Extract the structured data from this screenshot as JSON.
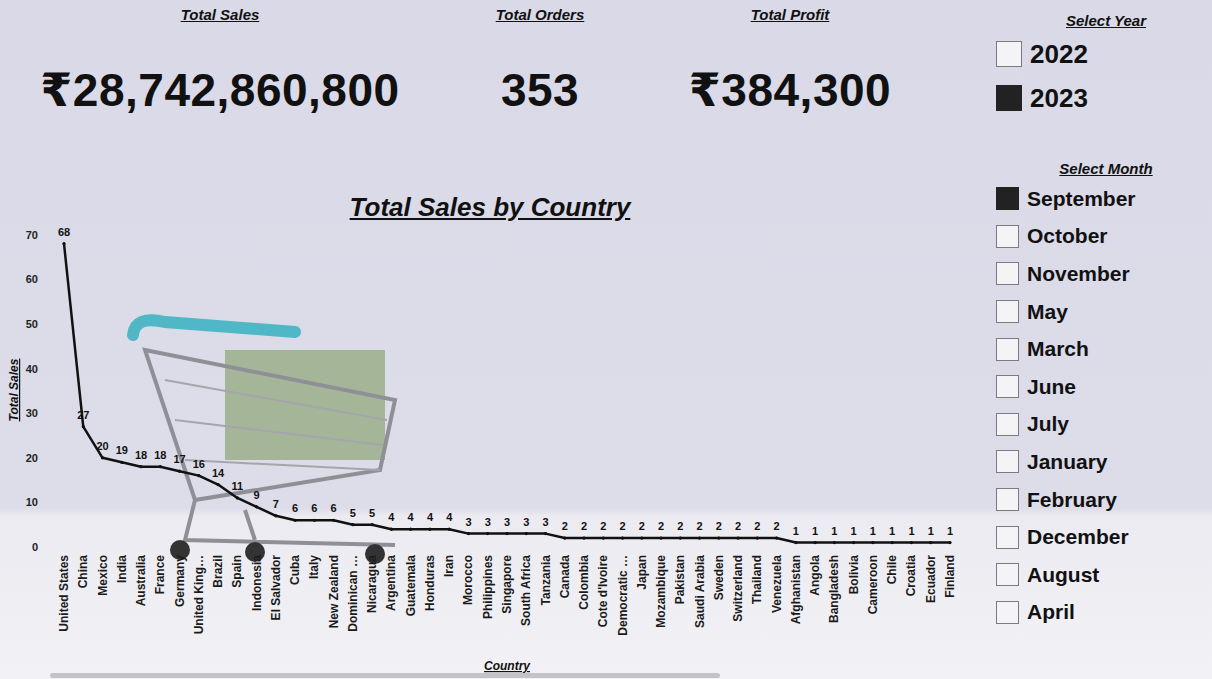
{
  "kpis": [
    {
      "title": "Total Sales",
      "value": "₹28,742,860,800"
    },
    {
      "title": "Total Orders",
      "value": "353"
    },
    {
      "title": "Total Profit",
      "value": "₹384,300"
    }
  ],
  "year_slicer": {
    "title": "Select Year",
    "items": [
      {
        "label": "2022",
        "selected": false
      },
      {
        "label": "2023",
        "selected": true
      }
    ]
  },
  "month_slicer": {
    "title": "Select Month",
    "items": [
      {
        "label": "September",
        "selected": true
      },
      {
        "label": "October",
        "selected": false
      },
      {
        "label": "November",
        "selected": false
      },
      {
        "label": "May",
        "selected": false
      },
      {
        "label": "March",
        "selected": false
      },
      {
        "label": "June",
        "selected": false
      },
      {
        "label": "July",
        "selected": false
      },
      {
        "label": "January",
        "selected": false
      },
      {
        "label": "February",
        "selected": false
      },
      {
        "label": "December",
        "selected": false
      },
      {
        "label": "August",
        "selected": false
      },
      {
        "label": "April",
        "selected": false
      }
    ]
  },
  "chart": {
    "title": "Total Sales by Country",
    "y_axis_title": "Total Sales",
    "x_axis_title": "Country",
    "y_ticks": [
      "0",
      "10",
      "20",
      "30",
      "40",
      "50",
      "60",
      "70"
    ],
    "categories": [
      "United States",
      "China",
      "Mexico",
      "India",
      "Australia",
      "France",
      "Germany",
      "United King…",
      "Brazil",
      "Spain",
      "Indonesia",
      "El Salvador",
      "Cuba",
      "Italy",
      "New Zealand",
      "Dominican …",
      "Nicaragua",
      "Argentina",
      "Guatemala",
      "Honduras",
      "Iran",
      "Morocco",
      "Philippines",
      "Singapore",
      "South Africa",
      "Tanzania",
      "Canada",
      "Colombia",
      "Cote d'Ivoire",
      "Democratic …",
      "Japan",
      "Mozambique",
      "Pakistan",
      "Saudi Arabia",
      "Sweden",
      "Switzerland",
      "Thailand",
      "Venezuela",
      "Afghanistan",
      "Angola",
      "Bangladesh",
      "Bolivia",
      "Cameroon",
      "Chile",
      "Croatia",
      "Ecuador",
      "Finland"
    ],
    "series": [
      {
        "values": [
          68,
          27,
          20,
          19,
          18,
          18,
          17,
          16,
          14,
          11,
          9,
          7,
          6,
          6,
          6,
          5,
          5,
          4,
          4,
          4,
          4,
          3,
          3,
          3,
          3,
          3,
          2,
          2,
          2,
          2,
          2,
          2,
          2,
          2,
          2,
          2,
          2,
          2,
          1,
          1,
          1,
          1,
          1,
          1,
          1,
          1,
          1
        ],
        "labels": [
          "68",
          "27",
          "20",
          "19",
          "18",
          "18",
          "17",
          "16",
          "14",
          "11",
          "9",
          "7",
          "6",
          "6",
          "6",
          "5",
          "5",
          "4",
          "4",
          "4",
          "4",
          "3",
          "3",
          "3",
          "3",
          "3",
          "2",
          "2",
          "2",
          "2",
          "2",
          "2",
          "2",
          "2",
          "2",
          "2",
          "2",
          "2",
          "1",
          "1",
          "1",
          "1",
          "1",
          "1",
          "1",
          "1",
          "1"
        ]
      }
    ]
  }
}
